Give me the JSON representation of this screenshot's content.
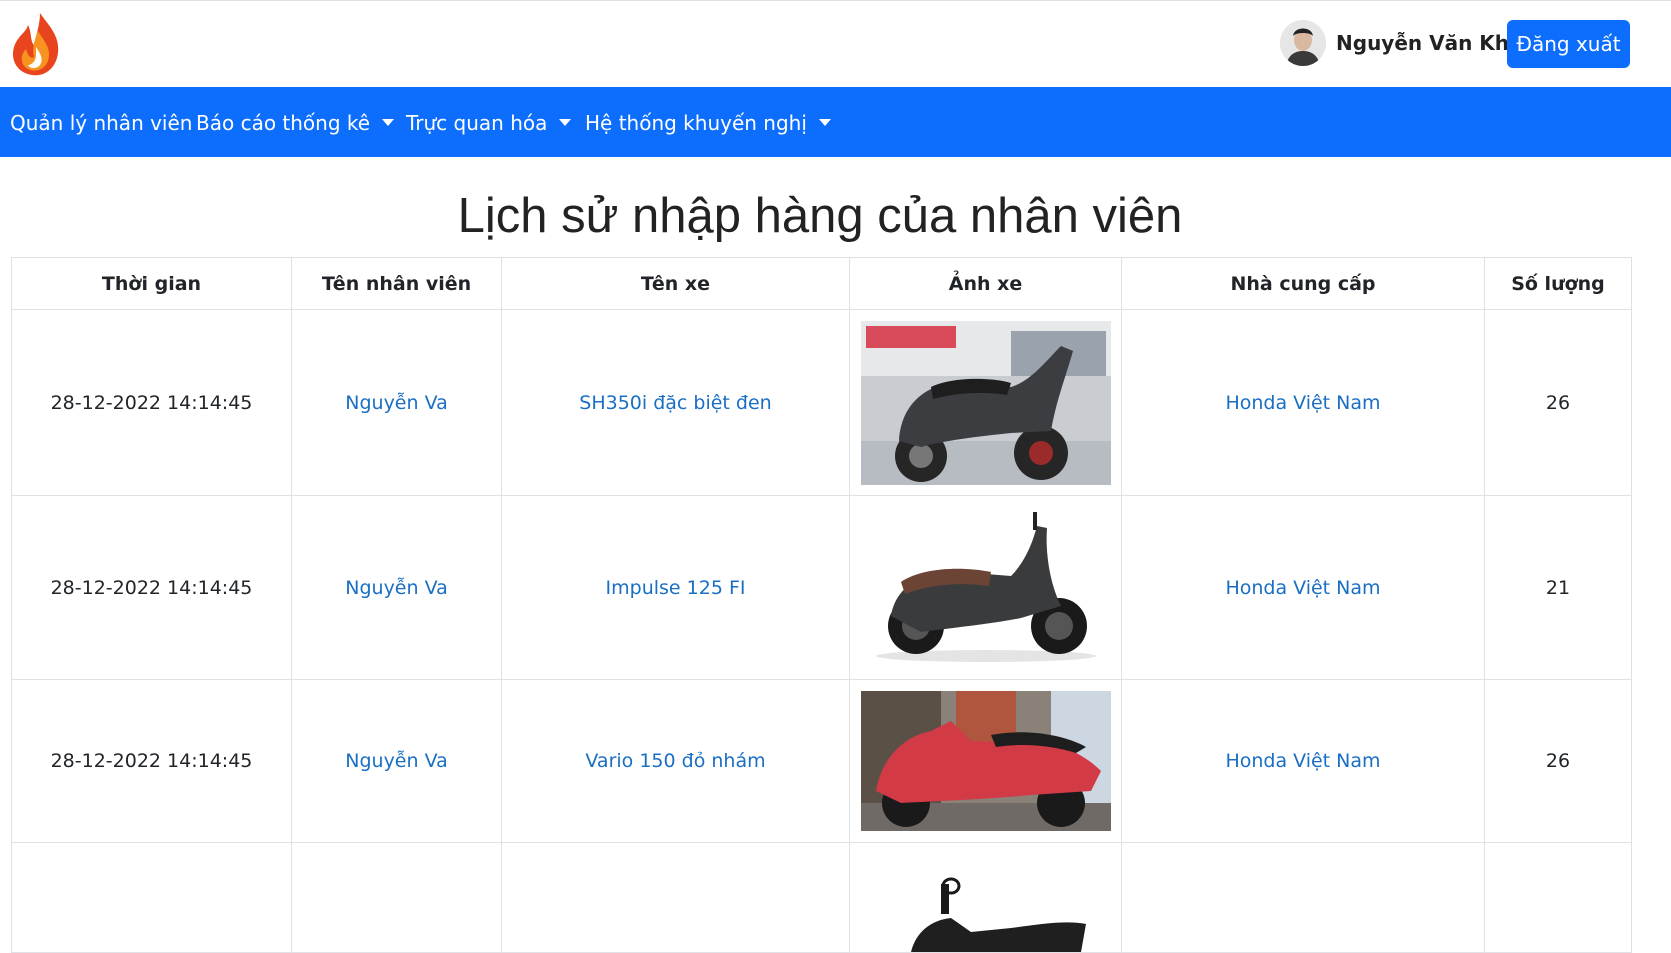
{
  "header": {
    "user_name": "Nguyễn Văn Khánh",
    "logout_label": "Đăng xuất"
  },
  "nav": {
    "items": [
      {
        "label": "Quản lý nhân viên",
        "has_dropdown": false
      },
      {
        "label": "Báo cáo thống kê",
        "has_dropdown": true
      },
      {
        "label": "Trực quan hóa",
        "has_dropdown": true
      },
      {
        "label": "Hệ thống khuyến nghị",
        "has_dropdown": true
      }
    ]
  },
  "page": {
    "title": "Lịch sử nhập hàng của nhân viên"
  },
  "table": {
    "columns": [
      "Thời gian",
      "Tên nhân viên",
      "Tên xe",
      "Ảnh xe",
      "Nhà cung cấp",
      "Số lượng"
    ],
    "rows": [
      {
        "time": "28-12-2022 14:14:45",
        "employee": "Nguyễn Va",
        "bike": "SH350i đặc biệt đen",
        "image": "black-scooter-showroom-photo",
        "supplier": "Honda Việt Nam",
        "quantity": "26"
      },
      {
        "time": "28-12-2022 14:14:45",
        "employee": "Nguyễn Va",
        "bike": "Impulse 125 FI",
        "image": "black-scooter-brown-seat-photo",
        "supplier": "Honda Việt Nam",
        "quantity": "21"
      },
      {
        "time": "28-12-2022 14:14:45",
        "employee": "Nguyễn Va",
        "bike": "Vario 150 đỏ nhám",
        "image": "red-scooter-street-photo",
        "supplier": "Honda Việt Nam",
        "quantity": "26"
      },
      {
        "time": "",
        "employee": "",
        "bike": "",
        "image": "black-scooter-photo",
        "supplier": "",
        "quantity": ""
      }
    ]
  },
  "colors": {
    "primary": "#0d6efd",
    "link": "#1a6fc4",
    "border": "#dee2e6"
  }
}
